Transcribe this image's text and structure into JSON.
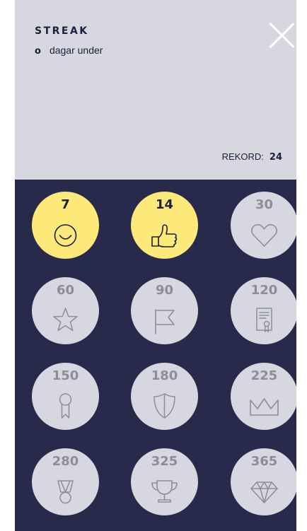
{
  "header": {
    "title": "STREAK",
    "streak_value": "o",
    "streak_label": "dagar under",
    "record_label": "REKORD:",
    "record_value": "24"
  },
  "colors": {
    "header_bg": "#d6d7df",
    "grid_bg": "#272a4a",
    "earned": "#fce97a",
    "locked": "#d6d7df",
    "locked_text": "#8c8d99",
    "text_dark": "#1d1e3a"
  },
  "badges": [
    {
      "days": "7",
      "icon": "smiley-icon",
      "earned": true
    },
    {
      "days": "14",
      "icon": "thumbs-up-icon",
      "earned": true
    },
    {
      "days": "30",
      "icon": "heart-icon",
      "earned": false
    },
    {
      "days": "60",
      "icon": "star-icon",
      "earned": false
    },
    {
      "days": "90",
      "icon": "flag-icon",
      "earned": false
    },
    {
      "days": "120",
      "icon": "certificate-icon",
      "earned": false
    },
    {
      "days": "150",
      "icon": "ribbon-icon",
      "earned": false
    },
    {
      "days": "180",
      "icon": "shield-icon",
      "earned": false
    },
    {
      "days": "225",
      "icon": "crown-icon",
      "earned": false
    },
    {
      "days": "280",
      "icon": "medal-icon",
      "earned": false
    },
    {
      "days": "325",
      "icon": "trophy-icon",
      "earned": false
    },
    {
      "days": "365",
      "icon": "diamond-icon",
      "earned": false
    }
  ]
}
